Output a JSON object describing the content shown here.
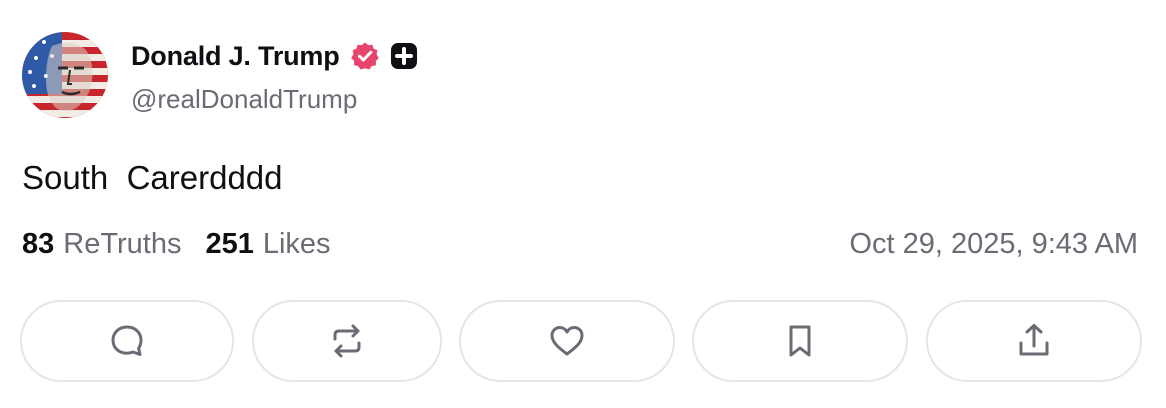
{
  "author": {
    "display_name": "Donald J. Trump",
    "handle": "@realDonaldTrump",
    "verified_icon": "verified-badge-icon",
    "verified_color": "#e8456c",
    "plus_badge_icon": "plus-badge-icon"
  },
  "post": {
    "text": "South  Carerdddd",
    "timestamp": "Oct 29, 2025, 9:43 AM"
  },
  "stats": {
    "retruths_count": "83",
    "retruths_label": "ReTruths",
    "likes_count": "251",
    "likes_label": "Likes"
  },
  "actions": [
    {
      "name": "reply",
      "icon": "comment-icon"
    },
    {
      "name": "retruth",
      "icon": "repost-icon"
    },
    {
      "name": "like",
      "icon": "heart-icon"
    },
    {
      "name": "bookmark",
      "icon": "bookmark-icon"
    },
    {
      "name": "share",
      "icon": "share-icon"
    }
  ],
  "colors": {
    "text_primary": "#0f0f14",
    "text_secondary": "#6b6b76",
    "button_border": "#e4e4ea",
    "icon_stroke": "#6b6b76"
  }
}
